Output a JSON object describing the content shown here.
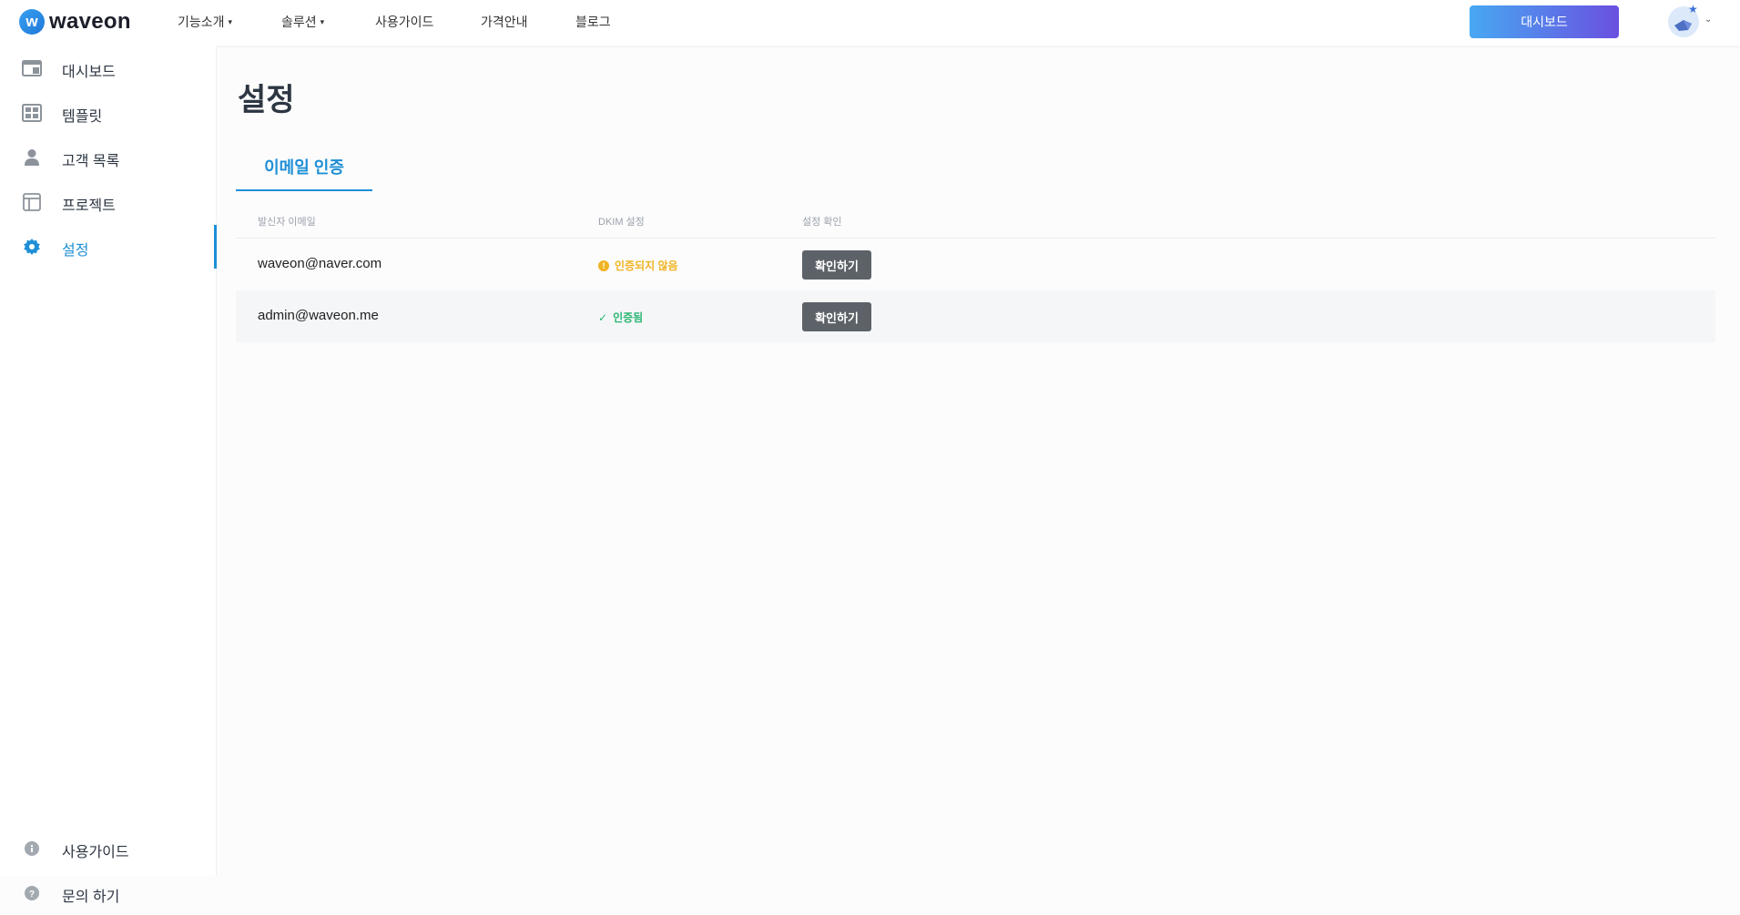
{
  "brand": {
    "logo_mark": "w",
    "name": "waveon"
  },
  "topnav": {
    "items": [
      {
        "label": "기능소개",
        "dropdown": true
      },
      {
        "label": "솔루션",
        "dropdown": true
      },
      {
        "label": "사용가이드",
        "dropdown": false
      },
      {
        "label": "가격안내",
        "dropdown": false
      },
      {
        "label": "블로그",
        "dropdown": false
      }
    ],
    "dashboard_button": "대시보드"
  },
  "sidebar": {
    "items": [
      {
        "label": "대시보드",
        "icon": "dashboard-icon"
      },
      {
        "label": "템플릿",
        "icon": "template-grid-icon"
      },
      {
        "label": "고객 목록",
        "icon": "person-icon"
      },
      {
        "label": "프로젝트",
        "icon": "layout-icon"
      },
      {
        "label": "설정",
        "icon": "gear-icon",
        "active": true
      }
    ],
    "bottom_items": [
      {
        "label": "사용가이드",
        "icon": "info-icon"
      },
      {
        "label": "문의 하기",
        "icon": "question-icon"
      }
    ]
  },
  "page": {
    "title": "설정",
    "tab": "이메일 인증"
  },
  "table": {
    "headers": [
      "발신자 이메일",
      "DKIM 설정",
      "설정 확인"
    ],
    "rows": [
      {
        "email": "waveon@naver.com",
        "status": "인증되지 않음",
        "status_type": "warning",
        "action": "확인하기"
      },
      {
        "email": "admin@waveon.me",
        "status": "인증됨",
        "status_type": "success",
        "action": "확인하기"
      }
    ]
  },
  "colors": {
    "accent": "#1e8fd6",
    "warning": "#f0b323",
    "success": "#2bb673",
    "button_dark": "#5c6268"
  }
}
